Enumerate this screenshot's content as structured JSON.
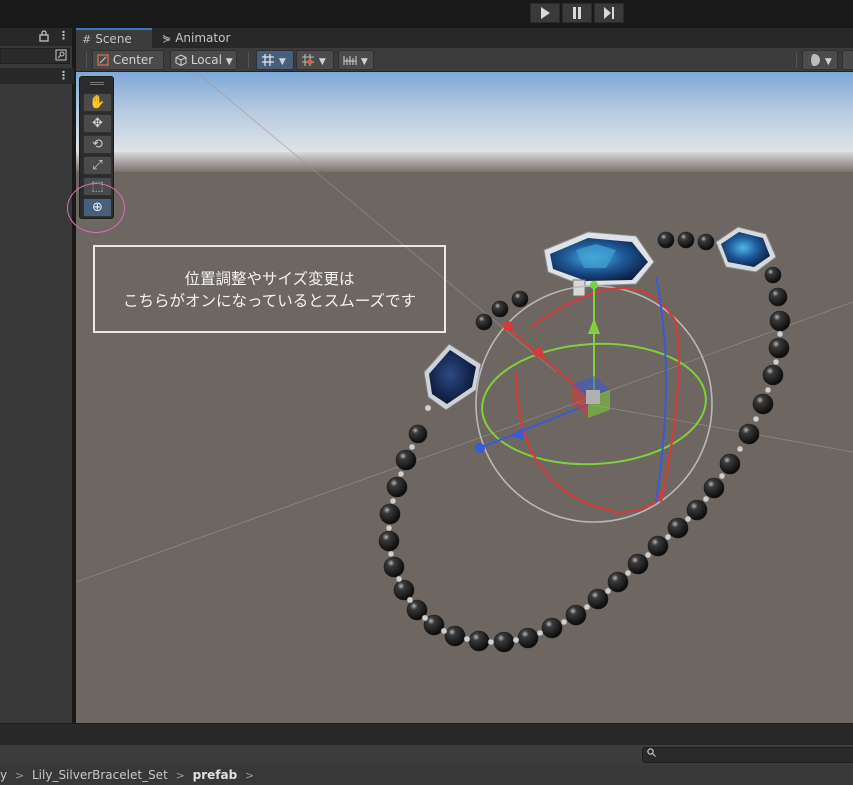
{
  "tabs": [
    {
      "label": "Scene",
      "icon": "grid-icon"
    },
    {
      "label": "Animator",
      "icon": "animator-icon"
    }
  ],
  "toolbar": {
    "pivot_mode": "Center",
    "pivot_rotation": "Local"
  },
  "tools": [
    "hand-tool",
    "move-tool",
    "rotate-tool",
    "scale-tool",
    "rect-tool",
    "transform-tool"
  ],
  "selected_tool": "transform-tool",
  "caption": {
    "line1": "位置調整やサイズ変更は",
    "line2": "こちらがオンになっているとスムーズです"
  },
  "breadcrumb": {
    "partial": "y",
    "item1": "Lily_SilverBracelet_Set",
    "item2": "prefab"
  },
  "colors": {
    "accent": "#46607c",
    "highlight_ring": "#d56fb9",
    "sky_top": "#7fa9d9",
    "ground": "#6f6762"
  }
}
